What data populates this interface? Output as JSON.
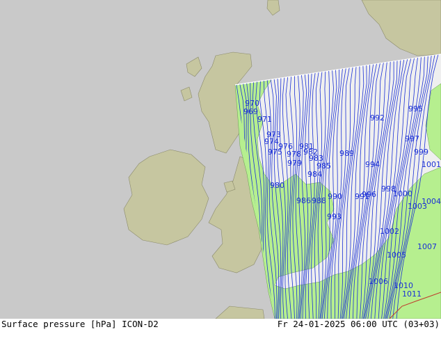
{
  "footer": {
    "product": "Surface pressure [hPa]",
    "model": "ICON-D2",
    "valid_time": "Fr 24-01-2025 06:00 UTC (03+03)"
  },
  "colors": {
    "sea_outside": "#c9c9c9",
    "land_outside": "#c6c6a0",
    "sea_domain": "#efefef",
    "land_domain": "#b6ef8f",
    "isobar": "#1a2fd6",
    "border": "#555555"
  },
  "isobar_labels": [
    {
      "text": "970"
    },
    {
      "text": "969"
    },
    {
      "text": "971"
    },
    {
      "text": "973"
    },
    {
      "text": "974"
    },
    {
      "text": "975"
    },
    {
      "text": "976"
    },
    {
      "text": "978"
    },
    {
      "text": "979"
    },
    {
      "text": "981"
    },
    {
      "text": "983"
    },
    {
      "text": "982"
    },
    {
      "text": "985"
    },
    {
      "text": "984"
    },
    {
      "text": "980"
    },
    {
      "text": "989"
    },
    {
      "text": "986"
    },
    {
      "text": "988"
    },
    {
      "text": "990"
    },
    {
      "text": "991"
    },
    {
      "text": "992"
    },
    {
      "text": "993"
    },
    {
      "text": "994"
    },
    {
      "text": "995"
    },
    {
      "text": "996"
    },
    {
      "text": "997"
    },
    {
      "text": "998"
    },
    {
      "text": "999"
    },
    {
      "text": "1000"
    },
    {
      "text": "1001"
    },
    {
      "text": "1002"
    },
    {
      "text": "1003"
    },
    {
      "text": "1004"
    },
    {
      "text": "1005"
    },
    {
      "text": "1006"
    },
    {
      "text": "1007"
    },
    {
      "text": "1010"
    },
    {
      "text": "1011"
    }
  ]
}
